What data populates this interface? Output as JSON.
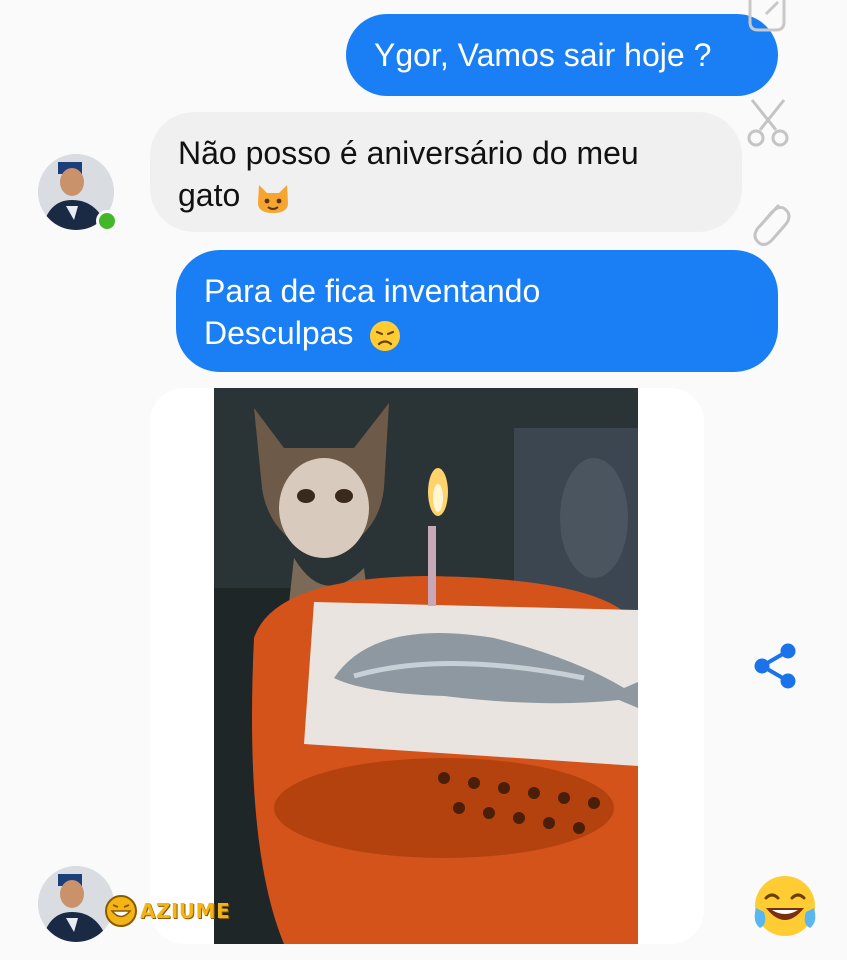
{
  "messages": [
    {
      "direction": "outgoing",
      "text": "Ygor, Vamos sair hoje ?"
    },
    {
      "direction": "incoming",
      "line1": "Não posso é aniversário do meu",
      "line2": "gato",
      "emoji": "cat-face-emoji"
    },
    {
      "direction": "outgoing",
      "line1": "Para de fica inventando",
      "line2": "Desculpas",
      "emoji": "sad-face-emoji"
    }
  ],
  "contact": {
    "online": true,
    "online_color": "#42b72a"
  },
  "icons": [
    "scissors-icon",
    "paperclip-icon",
    "share-icon",
    "laughing-emoji"
  ],
  "watermark": {
    "text": "AZIUME",
    "color": "#f3b516"
  },
  "colors": {
    "outgoing_bubble": "#1a7ff5",
    "incoming_bubble": "#f0f0f0",
    "accent": "#1a73e8"
  }
}
